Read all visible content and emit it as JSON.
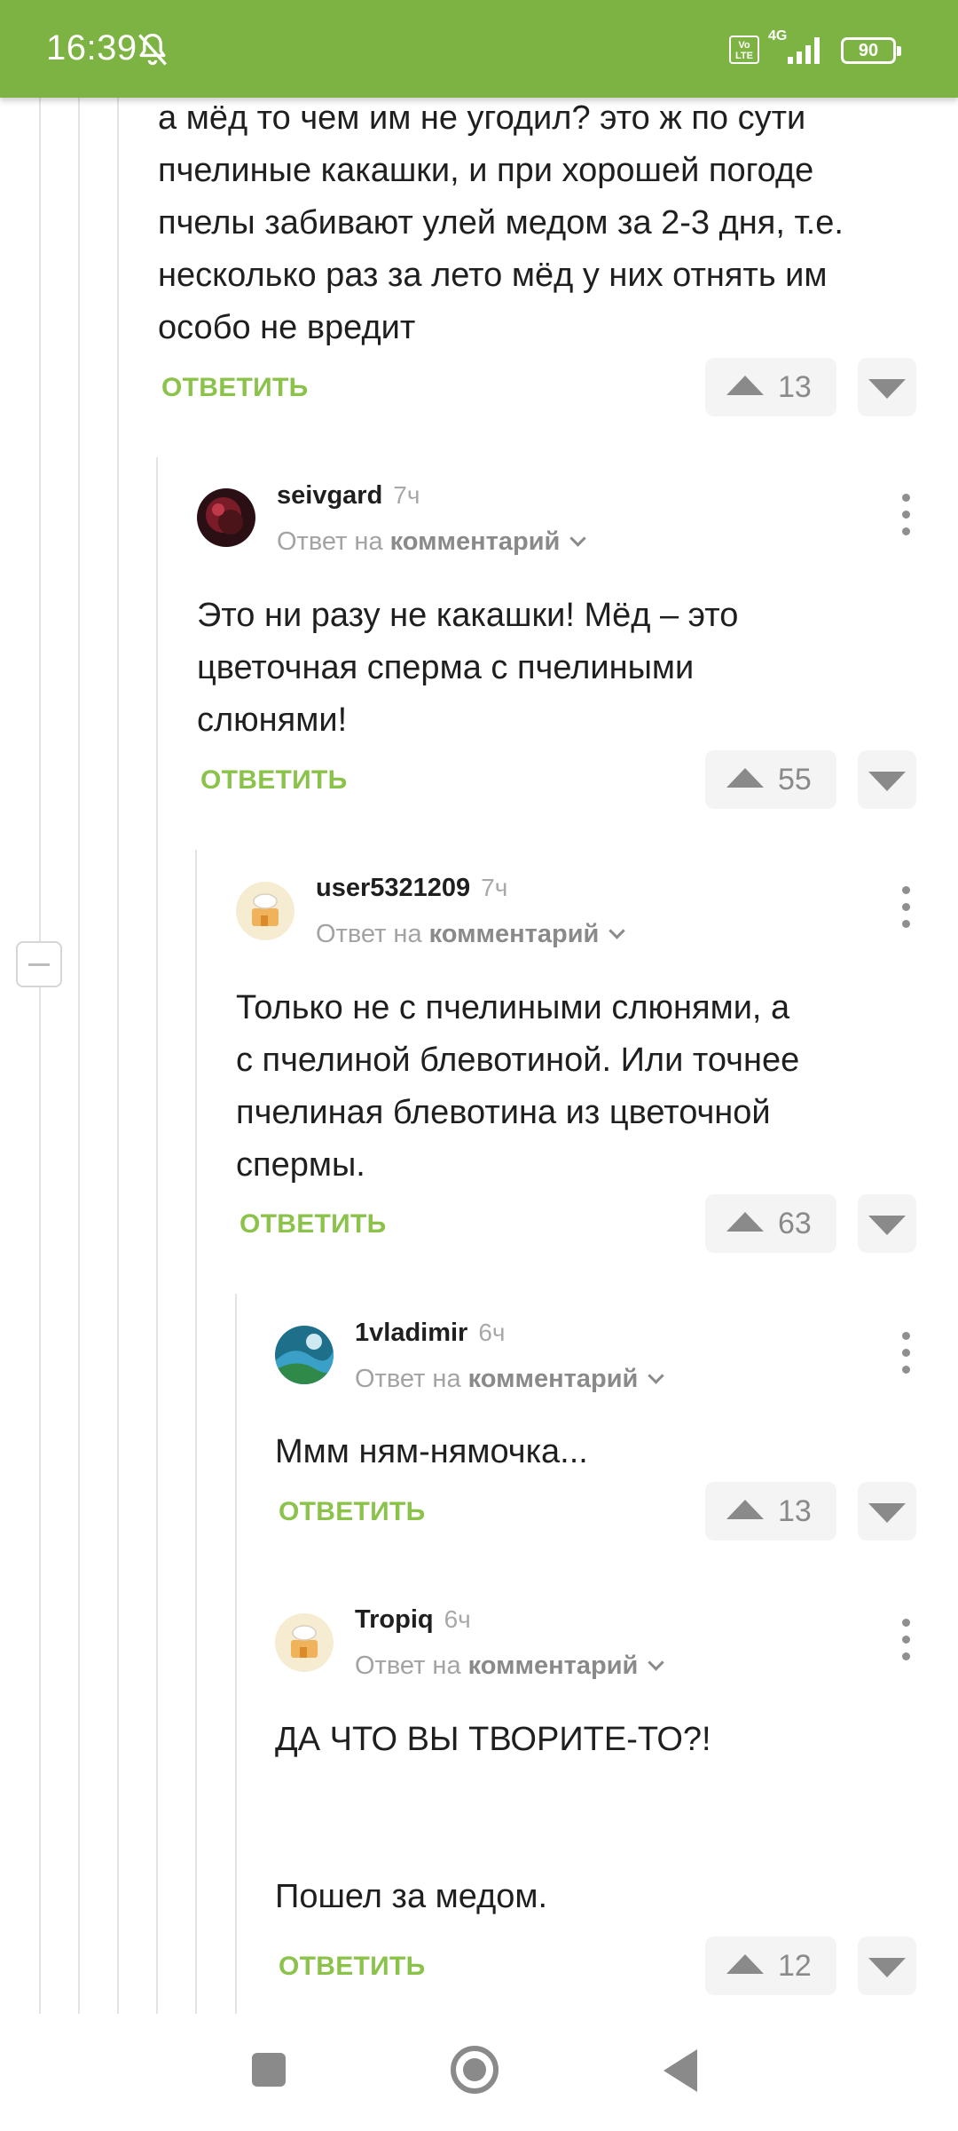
{
  "status_bar": {
    "time": "16:39",
    "network": "4G",
    "volte": "Vo LTE",
    "battery": "90",
    "icons": [
      "bell-muted-icon",
      "signal-icon",
      "battery-icon"
    ]
  },
  "colors": {
    "accent": "#7cb342",
    "reply_link": "#8bc34a",
    "muted": "#a3a3a3"
  },
  "comments": [
    {
      "text": "а мёд то чем им не угодил? это ж по сути\nпчелиные какашки, и при хорошей погоде\nпчелы забивают улей медом за 2-3 дня, т.е.\nнесколько раз за лето мёд у них отнять им\nособо не вредит",
      "reply_label": "ОТВЕТИТЬ",
      "score": "13"
    },
    {
      "username": "seivgard",
      "time": "7ч",
      "reply_to_prefix": "Ответ на",
      "reply_to_link": "комментарий",
      "text": "Это ни разу не какашки! Мёд – это\nцветочная сперма с пчелиными\nслюнями!",
      "reply_label": "ОТВЕТИТЬ",
      "score": "55"
    },
    {
      "username": "user5321209",
      "time": "7ч",
      "reply_to_prefix": "Ответ на",
      "reply_to_link": "комментарий",
      "text": "Только не с пчелиными слюнями, а\nс пчелиной блевотиной. Или точнее\nпчелиная блевотина из цветочной\nспермы.",
      "reply_label": "ОТВЕТИТЬ",
      "score": "63"
    },
    {
      "username": "1vladimir",
      "time": "6ч",
      "reply_to_prefix": "Ответ на",
      "reply_to_link": "комментарий",
      "text": "Ммм ням-нямочка...",
      "reply_label": "ОТВЕТИТЬ",
      "score": "13"
    },
    {
      "username": "Tropiq",
      "time": "6ч",
      "reply_to_prefix": "Ответ на",
      "reply_to_link": "комментарий",
      "text": "ДА ЧТО ВЫ ТВОРИТЕ-ТО?!\n\n\nПошел за медом.",
      "reply_label": "ОТВЕТИТЬ",
      "score": "12"
    }
  ]
}
